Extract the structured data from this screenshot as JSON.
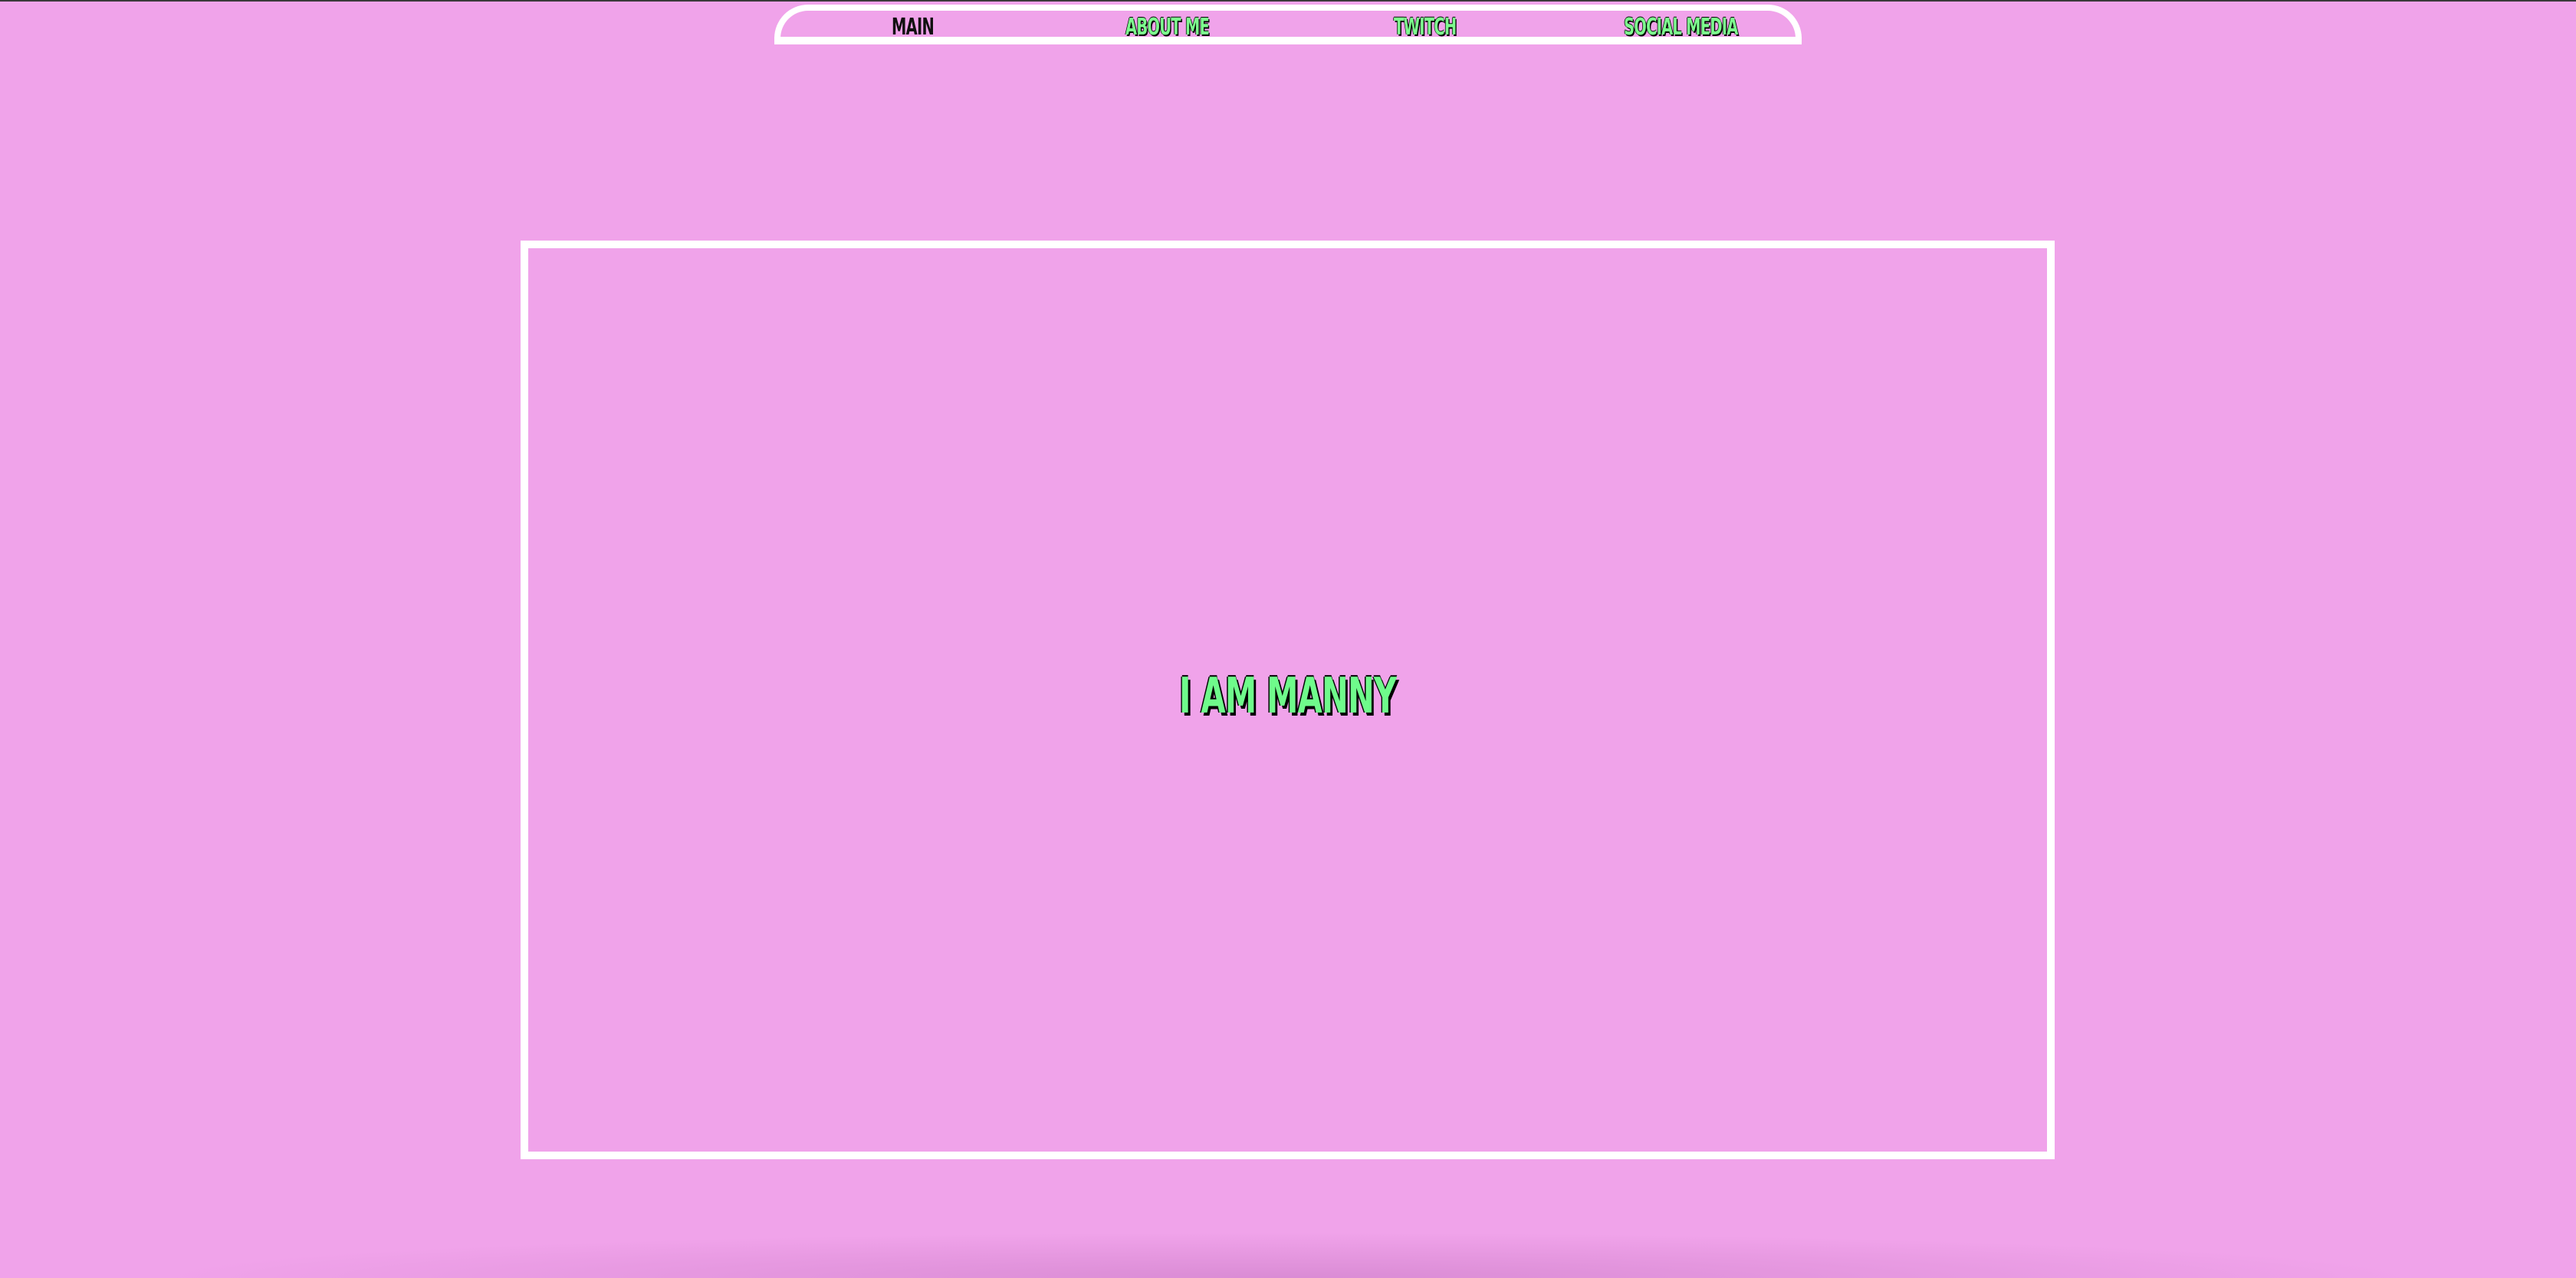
{
  "nav": {
    "items": [
      {
        "label": "MAIN",
        "active": true
      },
      {
        "label": "ABOUT ME",
        "active": false
      },
      {
        "label": "TWITCH",
        "active": false
      },
      {
        "label": "SOCIAL MEDIA",
        "active": false
      }
    ]
  },
  "hero": {
    "title": "I AM MANNY"
  },
  "colors": {
    "background": "#f0a3ea",
    "frame": "#ffffff",
    "accent_text": "#6ffb8b",
    "text_shadow": "#000000"
  }
}
